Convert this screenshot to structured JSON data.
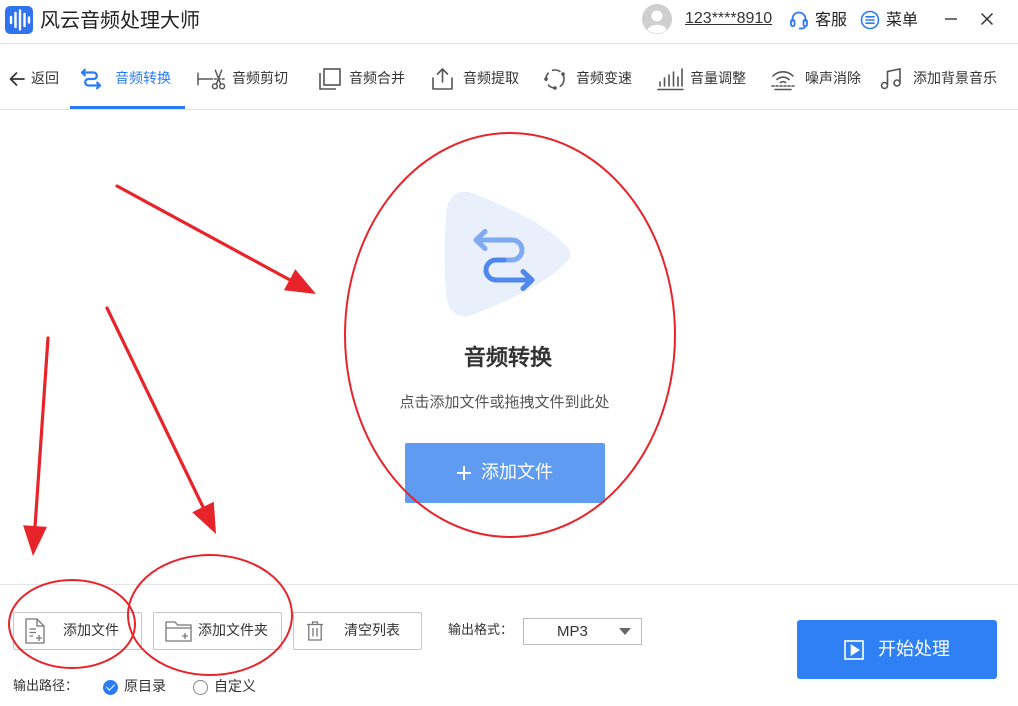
{
  "app": {
    "title": "风云音频处理大师"
  },
  "header": {
    "account": "123****8910",
    "service_label": "客服",
    "menu_label": "菜单"
  },
  "toolbar": {
    "back_label": "返回",
    "tabs": [
      {
        "label": "音频转换",
        "icon": "swap-icon",
        "active": true
      },
      {
        "label": "音频剪切",
        "icon": "scissors-icon",
        "active": false
      },
      {
        "label": "音频合并",
        "icon": "merge-icon",
        "active": false
      },
      {
        "label": "音频提取",
        "icon": "extract-icon",
        "active": false
      },
      {
        "label": "音频变速",
        "icon": "speed-icon",
        "active": false
      },
      {
        "label": "音量调整",
        "icon": "volume-icon",
        "active": false
      },
      {
        "label": "噪声消除",
        "icon": "noise-icon",
        "active": false
      },
      {
        "label": "添加背景音乐",
        "icon": "music-note-icon",
        "active": false
      }
    ]
  },
  "dropzone": {
    "title": "音频转换",
    "hint": "点击添加文件或拖拽文件到此处",
    "add_button": "添加文件"
  },
  "footer": {
    "add_file": "添加文件",
    "add_folder": "添加文件夹",
    "clear_list": "清空列表",
    "format_label": "输出格式：",
    "format_value": "MP3",
    "start_button": "开始处理",
    "path_label": "输出路径：",
    "path_options": [
      {
        "label": "原目录",
        "checked": true
      },
      {
        "label": "自定义",
        "checked": false
      }
    ]
  },
  "colors": {
    "accent": "#2b7cf4",
    "add_button": "#5f9cf1",
    "start_button": "#2f7ff5",
    "annotation": "#e8242b"
  }
}
